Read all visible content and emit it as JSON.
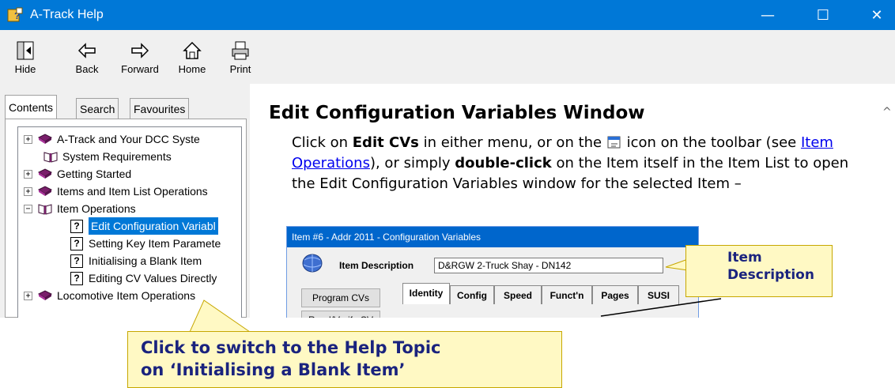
{
  "window": {
    "title": "A-Track Help",
    "minimize": "—",
    "maximize": "☐",
    "close": "✕"
  },
  "toolbar": {
    "buttons": [
      {
        "label": "Hide",
        "icon": "hide-icon"
      },
      {
        "label": "Back",
        "icon": "back-arrow-icon"
      },
      {
        "label": "Forward",
        "icon": "forward-arrow-icon"
      },
      {
        "label": "Home",
        "icon": "home-icon"
      },
      {
        "label": "Print",
        "icon": "printer-icon"
      }
    ]
  },
  "nav": {
    "tabs": [
      {
        "label": "Contents",
        "active": true
      },
      {
        "label": "Search",
        "active": false
      },
      {
        "label": "Favourites",
        "active": false
      }
    ],
    "tree": [
      {
        "label": "A-Track and Your DCC Syste",
        "type": "book",
        "expander": "+"
      },
      {
        "label": "System Requirements",
        "type": "page-book",
        "expander": ""
      },
      {
        "label": "Getting Started",
        "type": "book",
        "expander": "+"
      },
      {
        "label": "Items and Item List Operations",
        "type": "book",
        "expander": "+"
      },
      {
        "label": "Item Operations",
        "type": "open-book",
        "expander": "−"
      },
      {
        "label": "Edit Configuration Variabl",
        "type": "topic",
        "selected": true
      },
      {
        "label": "Setting Key Item Paramete",
        "type": "topic"
      },
      {
        "label": "Initialising a Blank Item",
        "type": "topic"
      },
      {
        "label": "Editing CV Values Directly",
        "type": "topic"
      },
      {
        "label": "Locomotive Item Operations",
        "type": "book",
        "expander": "+"
      }
    ]
  },
  "content": {
    "heading": "Edit Configuration Variables Window",
    "para": {
      "t1": "Click on ",
      "b1": "Edit CVs",
      "t2": " in either menu, or on the ",
      "t3": " icon on the toolbar (see ",
      "link": "Item Operations",
      "t4": "), or simply ",
      "b2": "double-click",
      "t5": " on the Item itself in the Item List to open the Edit Configuration Variables window for the selected Item –"
    },
    "screenshot": {
      "title": "Item #6 - Addr 2011 - Configuration Variables",
      "item_label": "Item Description",
      "item_value": "D&RGW 2-Truck Shay - DN142",
      "program_button": "Program CVs",
      "partial_button": "Read/Verify CV",
      "tabs": [
        "Identity",
        "Config",
        "Speed",
        "Funct'n",
        "Pages",
        "SUSI"
      ]
    }
  },
  "callouts": {
    "item_description": {
      "line1": "Item",
      "line2": "Description"
    },
    "switch_topic": {
      "line1": "Click to switch to the Help Topic",
      "line2": "on ‘Initialising a Blank Item’"
    }
  }
}
